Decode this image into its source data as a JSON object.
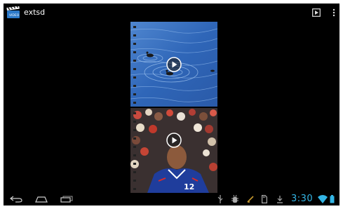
{
  "action_bar": {
    "title": "extsd",
    "app_icon": "video-gallery-clapper-icon",
    "slideshow_icon": "slideshow-play-icon",
    "menu_icon": "overflow-menu-icon"
  },
  "gallery": {
    "items": [
      {
        "type": "video",
        "thumbnail": "ducks-on-blue-water",
        "overlay_icon": "play-icon"
      },
      {
        "type": "video",
        "thumbnail": "football-player-blue-jersey",
        "overlay_icon": "play-icon",
        "jersey_number": "12"
      }
    ]
  },
  "nav_bar": {
    "back_icon": "back-icon",
    "home_icon": "home-icon",
    "recents_icon": "recent-apps-icon"
  },
  "status": {
    "notification_icons": [
      "usb-icon",
      "debug-icon",
      "battery-charging-icon",
      "sd-card-icon",
      "download-icon"
    ],
    "time": "3:30",
    "wifi_icon": "wifi-icon",
    "battery_icon": "battery-icon"
  },
  "colors": {
    "accent": "#33b5e5",
    "background": "#000000"
  }
}
